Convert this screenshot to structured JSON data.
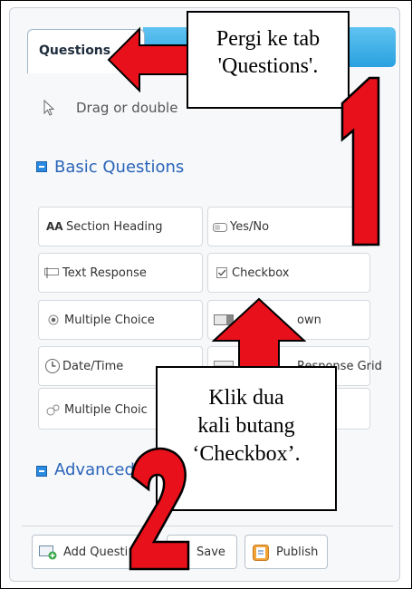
{
  "tabs": {
    "active_label": "Questions"
  },
  "hint": {
    "text": "Drag or double"
  },
  "sections": {
    "basic": "Basic Questions",
    "advanced": "Advanced"
  },
  "buttons": {
    "section_heading": "Section Heading",
    "yes_no": "Yes/No",
    "text_response": "Text Response",
    "checkbox": "Checkbox",
    "multiple_choice": "Multiple Choice",
    "dropdown": "own",
    "date_time": "Date/Time",
    "response_grid": "Response Grid",
    "multiple_choice_other": "Multiple Choic"
  },
  "footer": {
    "add_question": "Add Questi",
    "save": "Save",
    "publish": "Publish"
  },
  "annotations": {
    "callout1_line1": "Pergi ke tab",
    "callout1_line2": "'Questions'.",
    "callout2_line1": "Klik dua",
    "callout2_line2": "kali butang",
    "callout2_line3": "‘Checkbox’.",
    "step1": "1",
    "step2": "2"
  },
  "colors": {
    "accent_blue": "#2aa1e0",
    "arrow_red": "#e8101a",
    "title_blue": "#2a64b9"
  }
}
